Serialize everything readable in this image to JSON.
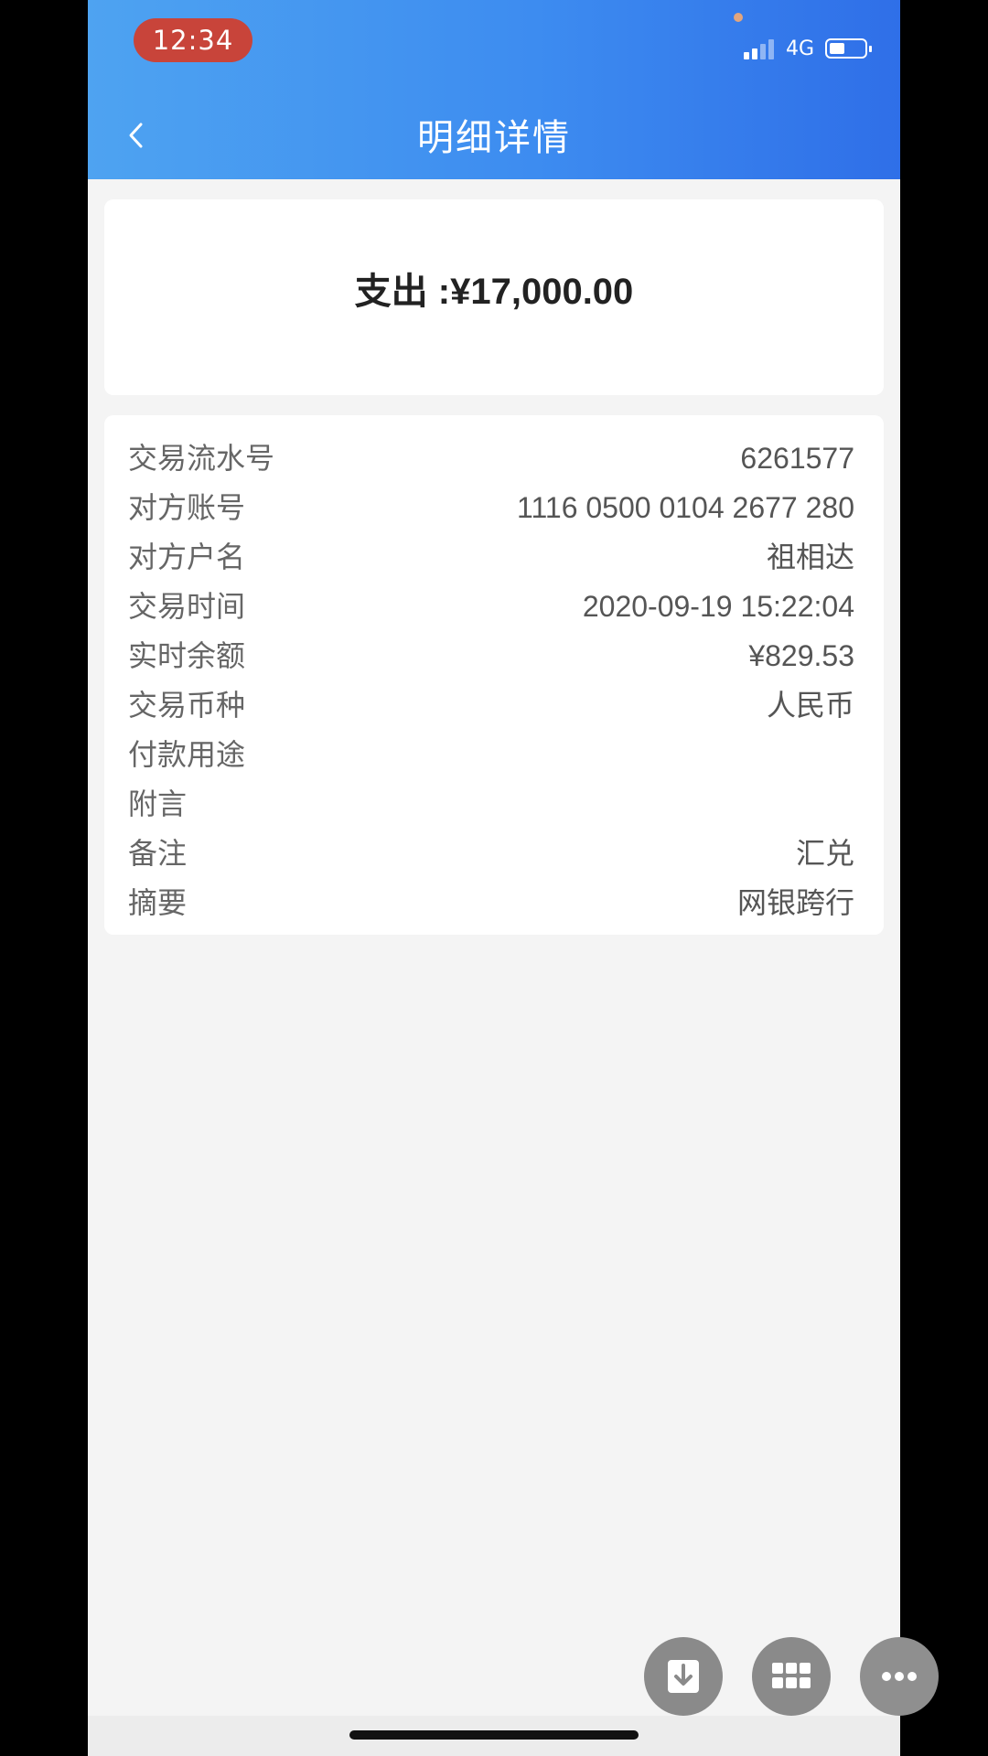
{
  "status_bar": {
    "time": "12:34",
    "network": "4G",
    "battery_level": 0.45
  },
  "header": {
    "title": "明细详情"
  },
  "amount_card": {
    "amount_text": "支出 :¥17,000.00"
  },
  "details": [
    {
      "label": "交易流水号",
      "value": "6261577"
    },
    {
      "label": "对方账号",
      "value": "1116 0500 0104 2677 280"
    },
    {
      "label": "对方户名",
      "value": "祖相达"
    },
    {
      "label": "交易时间",
      "value": "2020-09-19 15:22:04"
    },
    {
      "label": "实时余额",
      "value": "¥829.53"
    },
    {
      "label": "交易币种",
      "value": "人民币"
    },
    {
      "label": "付款用途",
      "value": ""
    },
    {
      "label": "附言",
      "value": ""
    },
    {
      "label": "备注",
      "value": "汇兑"
    },
    {
      "label": "摘要",
      "value": "网银跨行"
    }
  ],
  "colors": {
    "header_gradient_start": "#4ea3f1",
    "header_gradient_end": "#2f6fe8",
    "time_pill": "#c8443a"
  },
  "floating_buttons": [
    "download-icon",
    "grid-icon",
    "more-icon"
  ]
}
